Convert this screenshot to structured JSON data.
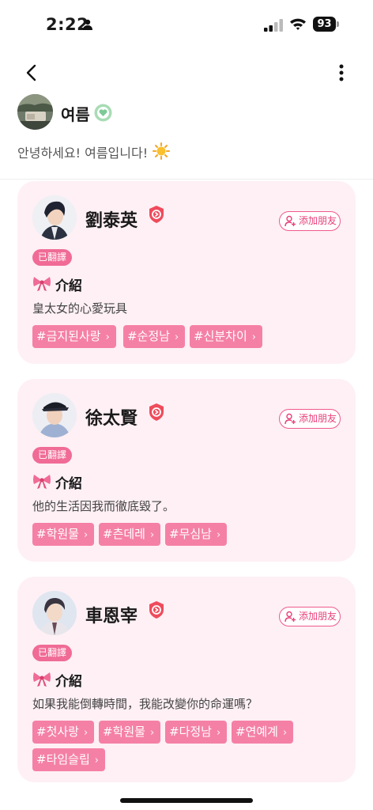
{
  "status_bar": {
    "time": "2:22",
    "battery": "93"
  },
  "profile": {
    "name": "여름",
    "greeting": "안녕하세요! 여름입니다!"
  },
  "cards": [
    {
      "name": "劉泰英",
      "add_friend": "添加朋友",
      "translated": "已翻譯",
      "intro_label": "介紹",
      "description": "皇太女的心愛玩具",
      "tags": [
        "#금지된사랑",
        "#순정남",
        "#신분차이"
      ]
    },
    {
      "name": "徐太賢",
      "add_friend": "添加朋友",
      "translated": "已翻譯",
      "intro_label": "介紹",
      "description": "他的生活因我而徹底毀了。",
      "tags": [
        "#학원물",
        "#츤데레",
        "#무심남"
      ]
    },
    {
      "name": "車恩宰",
      "add_friend": "添加朋友",
      "translated": "已翻譯",
      "intro_label": "介紹",
      "description": "如果我能倒轉時間，我能改變你的命運嗎？",
      "tags": [
        "#첫사랑",
        "#학원물",
        "#다정남",
        "#연예계",
        "#타임슬립"
      ]
    }
  ],
  "colors": {
    "accent": "#f06b96",
    "card_bg": "#fef0f5",
    "tag_bg": "#f580a6"
  },
  "icons": [
    "person-icon",
    "signal-icon",
    "wifi-icon",
    "battery-icon",
    "back-arrow-icon",
    "more-icon",
    "verified-badge-icon",
    "sun-emoji-icon",
    "shield-badge-icon",
    "add-friend-icon",
    "bow-icon",
    "chevron-right-icon"
  ]
}
